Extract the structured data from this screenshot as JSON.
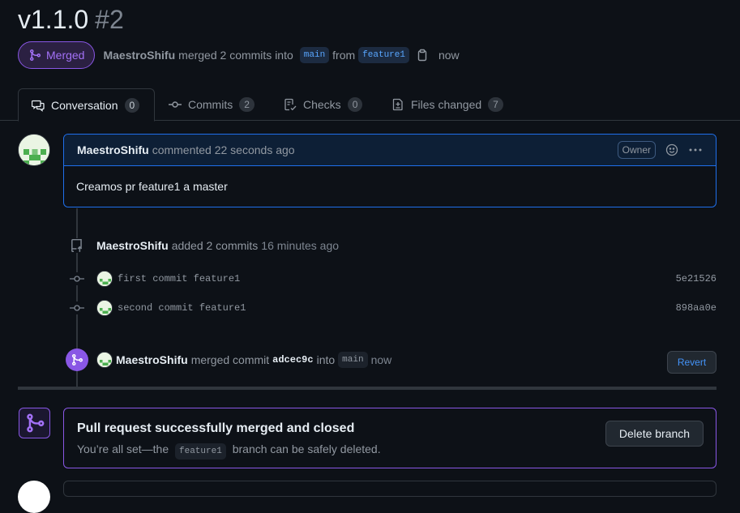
{
  "header": {
    "title": "v1.1.0",
    "number": "#2"
  },
  "state": {
    "badge_label": "Merged",
    "author": "MaestroShifu",
    "merged_text": "merged 2 commits into",
    "base_branch": "main",
    "from_text": "from",
    "head_branch": "feature1",
    "time": "now"
  },
  "tabs": [
    {
      "label": "Conversation",
      "count": "0",
      "icon": "comment-discussion-icon"
    },
    {
      "label": "Commits",
      "count": "2",
      "icon": "git-commit-icon"
    },
    {
      "label": "Checks",
      "count": "0",
      "icon": "checklist-icon"
    },
    {
      "label": "Files changed",
      "count": "7",
      "icon": "file-diff-icon"
    }
  ],
  "comment": {
    "author": "MaestroShifu",
    "meta": "commented 22 seconds ago",
    "owner_label": "Owner",
    "body": "Creamos pr feature1 a master"
  },
  "commits_event": {
    "author": "MaestroShifu",
    "action": "added 2 commits",
    "time": "16 minutes ago",
    "commits": [
      {
        "message": "first commit feature1",
        "sha": "5e21526"
      },
      {
        "message": "second commit feature1",
        "sha": "898aa0e"
      }
    ]
  },
  "merge_event": {
    "author": "MaestroShifu",
    "action": "merged commit",
    "sha": "adcec9c",
    "into_text": "into",
    "branch": "main",
    "time": "now",
    "revert_label": "Revert"
  },
  "merged_panel": {
    "title": "Pull request successfully merged and closed",
    "desc_prefix": "You’re all set—the",
    "branch": "feature1",
    "desc_suffix": "branch can be safely deleted.",
    "delete_label": "Delete branch"
  },
  "colors": {
    "merged_purple": "#8957e5",
    "accent_blue": "#1f6feb",
    "background": "#0d1117"
  }
}
